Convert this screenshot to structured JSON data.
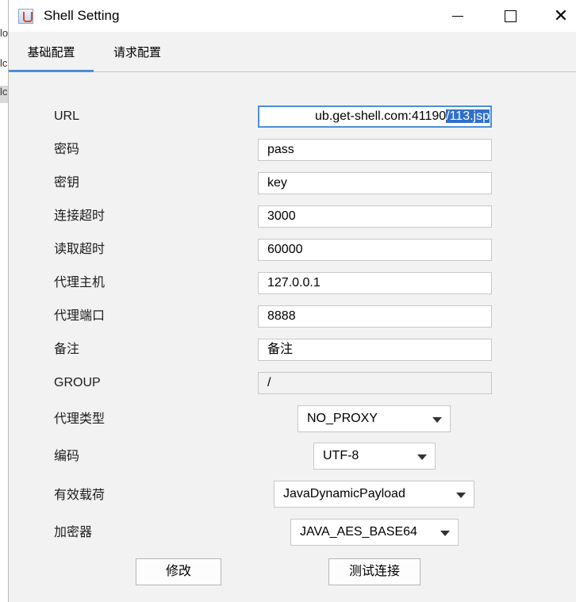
{
  "background_window": {
    "rows": [
      "lo",
      "lc",
      "lc"
    ]
  },
  "window": {
    "title": "Shell Setting",
    "minimize_glyph": "",
    "close_glyph": "✕"
  },
  "tabs": [
    {
      "label": "基础配置",
      "active": true
    },
    {
      "label": "请求配置",
      "active": false
    }
  ],
  "form": {
    "url": {
      "label": "URL",
      "value_unselected": "ub.get-shell.com:41190",
      "value_selected": "/113.jsp"
    },
    "password": {
      "label": "密码",
      "value": "pass"
    },
    "key": {
      "label": "密钥",
      "value": "key"
    },
    "connect_timeout": {
      "label": "连接超时",
      "value": "3000"
    },
    "read_timeout": {
      "label": "读取超时",
      "value": "60000"
    },
    "proxy_host": {
      "label": "代理主机",
      "value": "127.0.0.1"
    },
    "proxy_port": {
      "label": "代理端口",
      "value": "8888"
    },
    "remark": {
      "label": "备注",
      "value": "备注"
    },
    "group": {
      "label": "GROUP",
      "value": "/"
    },
    "proxy_type": {
      "label": "代理类型",
      "value": "NO_PROXY"
    },
    "encoding": {
      "label": "编码",
      "value": "UTF-8"
    },
    "payload": {
      "label": "有效载荷",
      "value": "JavaDynamicPayload"
    },
    "encryptor": {
      "label": "加密器",
      "value": "JAVA_AES_BASE64"
    }
  },
  "buttons": {
    "modify": "修改",
    "test_connection": "测试连接"
  },
  "colors": {
    "accent": "#4a90d9",
    "selection": "#2f6fcc",
    "window_bg": "#f2f2f2"
  }
}
